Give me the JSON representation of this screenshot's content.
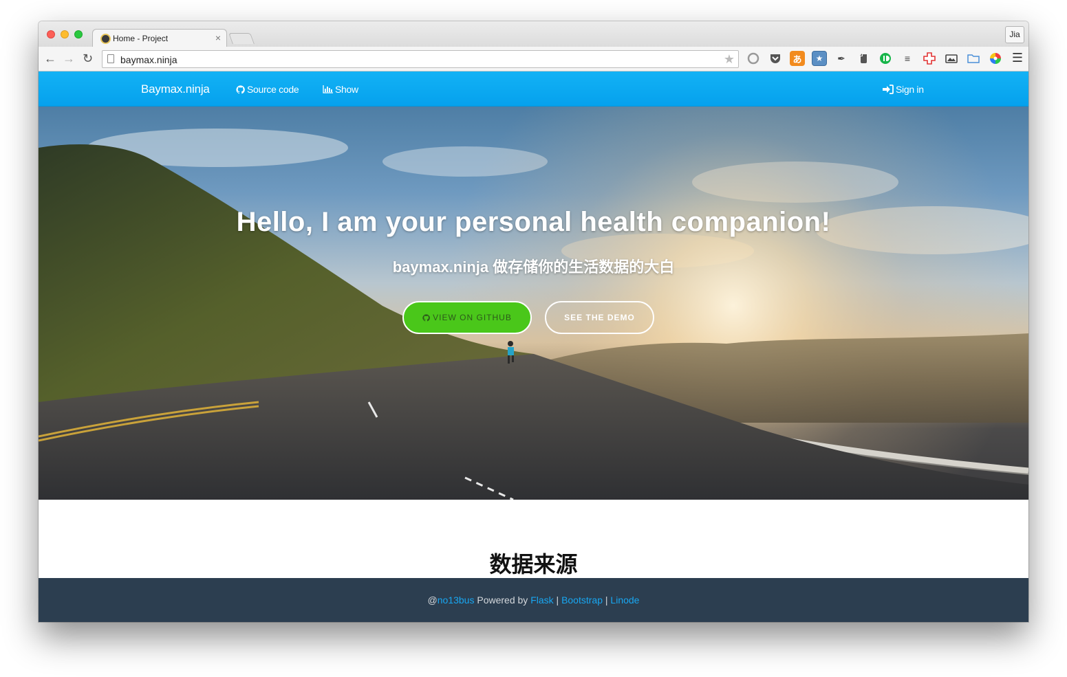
{
  "browser": {
    "tab_title": "Home - Project",
    "tab_close": "×",
    "profile": "Jia",
    "url": "baymax.ninja",
    "ext_icons": [
      "circle-icon",
      "pocket-icon",
      "translate-icon",
      "bookmark-star-icon",
      "pen-icon",
      "evernote-icon",
      "pushbullet-icon",
      "filter-icon",
      "medical-cross-icon",
      "screenshot-icon",
      "folder-icon",
      "color-wheel-icon"
    ]
  },
  "navbar": {
    "brand": "Baymax.ninja",
    "source_code": "Source code",
    "show": "Show",
    "sign_in": "Sign in"
  },
  "hero": {
    "title": "Hello, I am your personal health companion!",
    "subtitle": "baymax.ninja 做存储你的生活数据的大白",
    "github_button": "VIEW ON GITHUB",
    "demo_button": "SEE THE DEMO"
  },
  "section": {
    "title": "数据来源"
  },
  "footer": {
    "at": "@",
    "user": "no13bus",
    "powered_by": " Powered by ",
    "flask": "Flask",
    "sep1": " | ",
    "bootstrap": "Bootstrap",
    "sep2": " | ",
    "linode": "Linode"
  },
  "colors": {
    "navbar": "#05a1ed",
    "github_button": "#4ac71a",
    "footer_bg": "#2c3e50",
    "footer_link": "#18a7f2"
  }
}
